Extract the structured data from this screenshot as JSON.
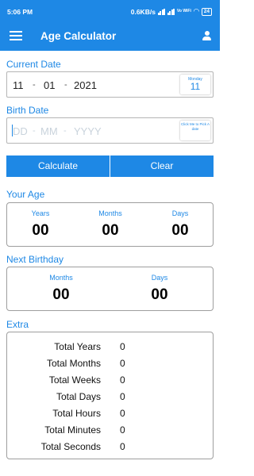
{
  "status_bar": {
    "time": "5:06 PM",
    "speed": "0.6KB/s",
    "network_label": "Vo WiFi",
    "battery": "24"
  },
  "app_bar": {
    "title": "Age Calculator",
    "menu_icon": "hamburger-menu-icon",
    "account_icon": "account-icon"
  },
  "current_date": {
    "label": "Current Date",
    "day": "11",
    "month": "01",
    "year": "2021",
    "separator": "-",
    "calendar_button": {
      "weekday": "Monday",
      "day": "11"
    }
  },
  "birth_date": {
    "label": "Birth Date",
    "day_placeholder": "DD",
    "month_placeholder": "MM",
    "year_placeholder": "YYYY",
    "separator": "-",
    "pick_button_label": "Click Me to Pick A date"
  },
  "actions": {
    "calculate_label": "Calculate",
    "clear_label": "Clear"
  },
  "your_age": {
    "label": "Your Age",
    "years_label": "Years",
    "months_label": "Months",
    "days_label": "Days",
    "years": "00",
    "months": "00",
    "days": "00"
  },
  "next_birthday": {
    "label": "Next Birthday",
    "months_label": "Months",
    "days_label": "Days",
    "months": "00",
    "days": "00"
  },
  "extra": {
    "label": "Extra",
    "rows": [
      {
        "label": "Total Years",
        "value": "0"
      },
      {
        "label": "Total Months",
        "value": "0"
      },
      {
        "label": "Total Weeks",
        "value": "0"
      },
      {
        "label": "Total Days",
        "value": "0"
      },
      {
        "label": "Total Hours",
        "value": "0"
      },
      {
        "label": "Total Minutes",
        "value": "0"
      },
      {
        "label": "Total Seconds",
        "value": "0"
      }
    ]
  },
  "colors": {
    "accent": "#1e88e5",
    "placeholder": "#c9d3dc",
    "card_border": "#9e9e9e"
  }
}
